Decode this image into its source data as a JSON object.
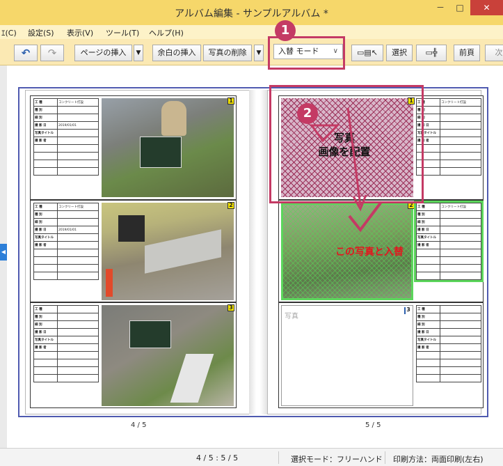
{
  "window": {
    "title": "アルバム編集 - サンプルアルバム *",
    "minimize": "－",
    "maximize": "□",
    "close": "✕"
  },
  "menu": [
    "ｴ(C)",
    "設定(S)",
    "表示(V)",
    "ツール(T)",
    "ヘルプ(H)"
  ],
  "toolbar": {
    "undo_icon": "↶",
    "redo_icon": "↷",
    "insert_page": "ページの挿入",
    "insert_blank": "余白の挿入",
    "delete_photo": "写真の削除",
    "mode_value": "入替 モード",
    "select": "選択",
    "prev": "前頁",
    "next": "次"
  },
  "left_page": {
    "number": "4 / 5",
    "slots": [
      {
        "num": "1",
        "rows": [
          [
            "工 種",
            "コンクリート打設"
          ],
          [
            "種 別",
            ""
          ],
          [
            "細 別",
            ""
          ],
          [
            "撮 影 日",
            "2019/01/01"
          ],
          [
            "写真タイトル",
            ""
          ],
          [
            "撮 影 者",
            ""
          ],
          [
            "",
            ""
          ],
          [
            "",
            ""
          ],
          [
            "",
            ""
          ],
          [
            "",
            ""
          ]
        ]
      },
      {
        "num": "2",
        "rows": [
          [
            "工 種",
            "コンクリート打設"
          ],
          [
            "種 別",
            ""
          ],
          [
            "細 別",
            ""
          ],
          [
            "撮 影 日",
            "2019/01/01"
          ],
          [
            "写真タイトル",
            ""
          ],
          [
            "撮 影 者",
            ""
          ],
          [
            "",
            ""
          ],
          [
            "",
            ""
          ],
          [
            "",
            ""
          ],
          [
            "",
            ""
          ]
        ]
      },
      {
        "num": "3",
        "rows": [
          [
            "工 種",
            ""
          ],
          [
            "種 別",
            ""
          ],
          [
            "細 別",
            ""
          ],
          [
            "撮 影 日",
            ""
          ],
          [
            "写真タイトル",
            ""
          ],
          [
            "撮 影 者",
            ""
          ],
          [
            "",
            ""
          ],
          [
            "",
            ""
          ],
          [
            "",
            ""
          ],
          [
            "",
            ""
          ]
        ]
      }
    ]
  },
  "right_page": {
    "number": "5 / 5",
    "empty_photo_label": "写真",
    "slots": [
      {
        "num": "1",
        "rows": [
          [
            "工 種",
            "コンクリート打設"
          ],
          [
            "種 別",
            ""
          ],
          [
            "細 別",
            ""
          ],
          [
            "撮 影 日",
            ""
          ],
          [
            "写真タイトル",
            ""
          ],
          [
            "撮 影 者",
            ""
          ],
          [
            "",
            ""
          ],
          [
            "",
            ""
          ],
          [
            "",
            ""
          ],
          [
            "",
            ""
          ]
        ]
      },
      {
        "num": "2",
        "rows": [
          [
            "工 種",
            "コンクリート打設"
          ],
          [
            "種 別",
            ""
          ],
          [
            "細 別",
            ""
          ],
          [
            "撮 影 日",
            ""
          ],
          [
            "写真タイトル",
            ""
          ],
          [
            "撮 影 者",
            ""
          ],
          [
            "",
            ""
          ],
          [
            "",
            ""
          ],
          [
            "",
            ""
          ],
          [
            "",
            ""
          ]
        ]
      },
      {
        "num": "3",
        "rows": [
          [
            "工 種",
            ""
          ],
          [
            "種 別",
            ""
          ],
          [
            "細 別",
            ""
          ],
          [
            "撮 影 日",
            ""
          ],
          [
            "写真タイトル",
            ""
          ],
          [
            "撮 影 者",
            ""
          ],
          [
            "",
            ""
          ],
          [
            "",
            ""
          ],
          [
            "",
            ""
          ],
          [
            "",
            ""
          ]
        ]
      }
    ]
  },
  "annotations": {
    "badge1": "1",
    "badge2": "2",
    "drag_line1": "写真",
    "drag_line2": "画像を配置",
    "swap_label": "この写真と入替"
  },
  "status": {
    "pages": "4 / 5 : 5 / 5",
    "select_mode": "選択モード：フリーハンド",
    "print_mode": "印刷方法：両面印刷(左右)"
  },
  "colors": {
    "accent": "#c43a64",
    "titlebar": "#f6d76a",
    "frame": "#4f5ab0",
    "swap_text": "#e4151d"
  }
}
